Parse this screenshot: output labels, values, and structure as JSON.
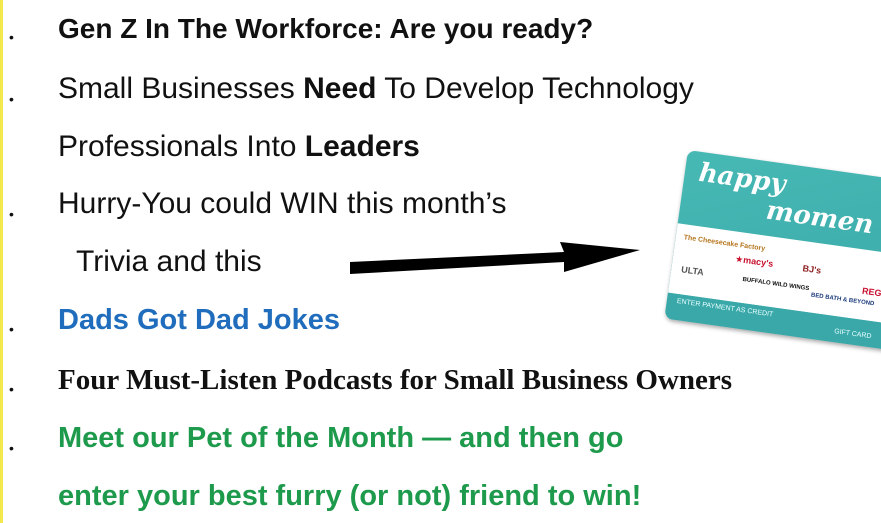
{
  "items": [
    {
      "text": "Gen Z In The Workforce: Are you ready?"
    },
    {
      "parts": [
        "Small Businesses ",
        "Need",
        " To Develop Technology"
      ]
    },
    {
      "parts": [
        "Professionals Into ",
        "Leaders"
      ]
    },
    {
      "text": "Hurry-You could WIN this month’s"
    },
    {
      "text": "Trivia and this"
    },
    {
      "text": "Dads Got Dad Jokes"
    },
    {
      "text": "Four Must-Listen Podcasts for Small Business Owners"
    },
    {
      "text": "Meet our Pet of the Month — and then go"
    },
    {
      "text": "enter your best furry (or not) friend to win!"
    }
  ],
  "bullet_glyph": "•",
  "gift_card": {
    "logo_line1": "happy",
    "logo_line2": "momen",
    "brands": [
      "The Cheesecake Factory",
      "★macy's",
      "BJ's",
      "ULTA",
      "BUFFALO WILD WINGS",
      "BED BATH & BEYOND",
      "REGAL"
    ],
    "strip_left": "ENTER PAYMENT AS CREDIT",
    "strip_right": "GIFT CARD"
  },
  "colors": {
    "blue": "#1f6dbc",
    "green": "#1e9a4c",
    "accent_bar": "#f4e94c",
    "card_teal": "#47b9b4"
  }
}
